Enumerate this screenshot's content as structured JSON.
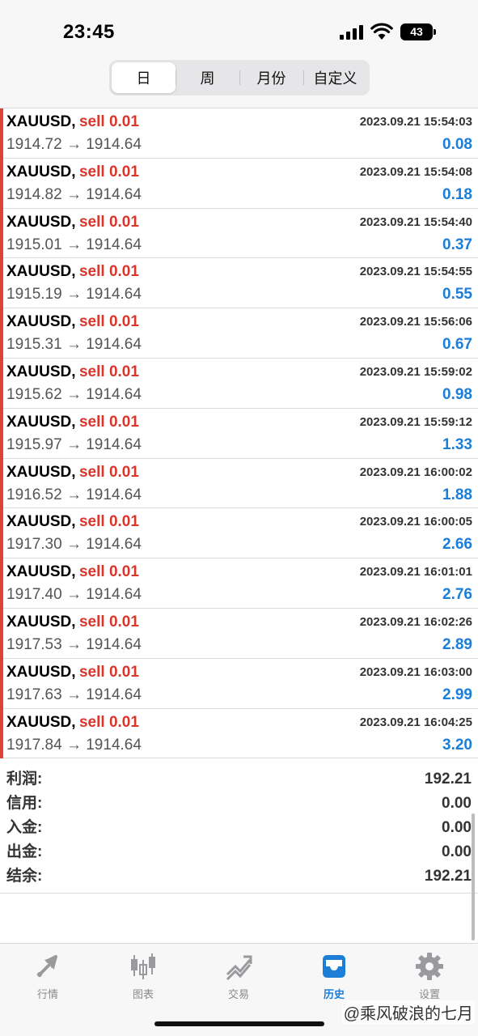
{
  "status_bar": {
    "time": "23:45",
    "battery": "43"
  },
  "period_tabs": [
    {
      "label": "日",
      "active": true
    },
    {
      "label": "周",
      "active": false
    },
    {
      "label": "月份",
      "active": false
    },
    {
      "label": "自定义",
      "active": false
    }
  ],
  "trades": [
    {
      "symbol": "XAUUSD,",
      "side": "sell 0.01",
      "datetime": "2023.09.21 15:54:03",
      "prices": "1914.72 → 1914.64",
      "profit": "0.08"
    },
    {
      "symbol": "XAUUSD,",
      "side": "sell 0.01",
      "datetime": "2023.09.21 15:54:08",
      "prices": "1914.82 → 1914.64",
      "profit": "0.18"
    },
    {
      "symbol": "XAUUSD,",
      "side": "sell 0.01",
      "datetime": "2023.09.21 15:54:40",
      "prices": "1915.01 → 1914.64",
      "profit": "0.37"
    },
    {
      "symbol": "XAUUSD,",
      "side": "sell 0.01",
      "datetime": "2023.09.21 15:54:55",
      "prices": "1915.19 → 1914.64",
      "profit": "0.55"
    },
    {
      "symbol": "XAUUSD,",
      "side": "sell 0.01",
      "datetime": "2023.09.21 15:56:06",
      "prices": "1915.31 → 1914.64",
      "profit": "0.67"
    },
    {
      "symbol": "XAUUSD,",
      "side": "sell 0.01",
      "datetime": "2023.09.21 15:59:02",
      "prices": "1915.62 → 1914.64",
      "profit": "0.98"
    },
    {
      "symbol": "XAUUSD,",
      "side": "sell 0.01",
      "datetime": "2023.09.21 15:59:12",
      "prices": "1915.97 → 1914.64",
      "profit": "1.33"
    },
    {
      "symbol": "XAUUSD,",
      "side": "sell 0.01",
      "datetime": "2023.09.21 16:00:02",
      "prices": "1916.52 → 1914.64",
      "profit": "1.88"
    },
    {
      "symbol": "XAUUSD,",
      "side": "sell 0.01",
      "datetime": "2023.09.21 16:00:05",
      "prices": "1917.30 → 1914.64",
      "profit": "2.66"
    },
    {
      "symbol": "XAUUSD,",
      "side": "sell 0.01",
      "datetime": "2023.09.21 16:01:01",
      "prices": "1917.40 → 1914.64",
      "profit": "2.76"
    },
    {
      "symbol": "XAUUSD,",
      "side": "sell 0.01",
      "datetime": "2023.09.21 16:02:26",
      "prices": "1917.53 → 1914.64",
      "profit": "2.89"
    },
    {
      "symbol": "XAUUSD,",
      "side": "sell 0.01",
      "datetime": "2023.09.21 16:03:00",
      "prices": "1917.63 → 1914.64",
      "profit": "2.99"
    },
    {
      "symbol": "XAUUSD,",
      "side": "sell 0.01",
      "datetime": "2023.09.21 16:04:25",
      "prices": "1917.84 → 1914.64",
      "profit": "3.20"
    }
  ],
  "summary": [
    {
      "label": "利润:",
      "value": "192.21"
    },
    {
      "label": "信用:",
      "value": "0.00"
    },
    {
      "label": "入金:",
      "value": "0.00"
    },
    {
      "label": "出金:",
      "value": "0.00"
    },
    {
      "label": "结余:",
      "value": "192.21"
    }
  ],
  "tabbar": [
    {
      "label": "行情",
      "icon": "quotes-arrow-icon",
      "active": false
    },
    {
      "label": "图表",
      "icon": "candlestick-chart-icon",
      "active": false
    },
    {
      "label": "交易",
      "icon": "trade-trend-icon",
      "active": false
    },
    {
      "label": "历史",
      "icon": "history-inbox-icon",
      "active": true
    },
    {
      "label": "设置",
      "icon": "gear-icon",
      "active": false
    }
  ],
  "watermark": "@乘风破浪的七月",
  "colors": {
    "accent": "#1c7ed6",
    "sell": "#d9352b",
    "row_marker": "#d9443a"
  }
}
